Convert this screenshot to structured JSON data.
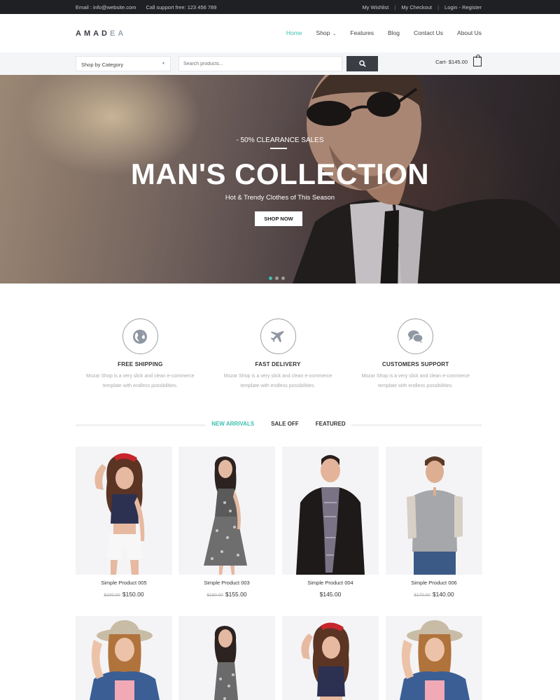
{
  "topbar": {
    "email": "Email : info@website.com",
    "phone": "Call support free: 123 456 789",
    "links": [
      "My Wishlist",
      "My Checkout",
      "Login - Register"
    ]
  },
  "header": {
    "logo_main": "AMAD",
    "logo_accent": "EA",
    "nav": [
      {
        "label": "Home",
        "active": true
      },
      {
        "label": "Shop",
        "dropdown": true
      },
      {
        "label": "Features"
      },
      {
        "label": "Blog"
      },
      {
        "label": "Contact Us"
      },
      {
        "label": "About Us"
      }
    ]
  },
  "search": {
    "category_label": "Shop by Category",
    "placeholder": "Search products...",
    "cart_label": "Cart- $145.00"
  },
  "hero": {
    "kicker": "- 50% CLEARANCE SALES",
    "title": "MAN'S COLLECTION",
    "subtitle": "Hot & Trendy Clothes of This Season",
    "button": "SHOP NOW",
    "slides": 3,
    "active_slide": 1
  },
  "features": [
    {
      "icon": "globe-icon",
      "title": "FREE SHIPPING",
      "desc1": "Mozar Shop is a very slick and clean e-commerce",
      "desc2": "template with endless possibilities."
    },
    {
      "icon": "airplane-icon",
      "title": "FAST DELIVERY",
      "desc1": "Mozar Shop is a very slick and clean e-commerce",
      "desc2": "template with endless possibilities."
    },
    {
      "icon": "chat-bubbles-icon",
      "title": "CUSTOMERS SUPPORT",
      "desc1": "Mozar Shop is a very slick and clean e-commerce",
      "desc2": "template with endless possibilities."
    }
  ],
  "tabs": [
    {
      "label": "NEW ARRIVALS",
      "active": true
    },
    {
      "label": "SALE OFF"
    },
    {
      "label": "FEATURED"
    }
  ],
  "products": [
    {
      "name": "Simple Product 005",
      "old_price": "$200.00",
      "price": "$150.00"
    },
    {
      "name": "Simple Product 003",
      "old_price": "$180.00",
      "price": "$155.00"
    },
    {
      "name": "Simple Product 004",
      "old_price": "",
      "price": "$145.00"
    },
    {
      "name": "Simple Product 006",
      "old_price": "$170.00",
      "price": "$140.00"
    }
  ],
  "colors": {
    "accent": "#3bbfae",
    "topbar": "#1f2024",
    "dark_button": "#3a3d44"
  }
}
